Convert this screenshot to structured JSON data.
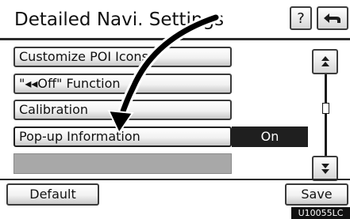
{
  "header": {
    "title": "Detailed Navi. Settings",
    "help_label": "?",
    "back_icon": "back-arrow-icon"
  },
  "menu": {
    "items": [
      {
        "label": "Customize POI Icons"
      },
      {
        "label": "\"◂◂Off\" Function"
      },
      {
        "label": "Calibration"
      },
      {
        "label": "Pop-up Information",
        "value": "On"
      }
    ]
  },
  "scroll": {
    "up_label": "▲\n▲",
    "down_label": "▼\n▼"
  },
  "footer": {
    "default_label": "Default",
    "save_label": "Save"
  },
  "figure_code": "U10055LC",
  "colors": {
    "selected_value_bg": "#1f1f1f",
    "empty_row": "#a8a8a8",
    "annotation_arrow": "#000000"
  }
}
